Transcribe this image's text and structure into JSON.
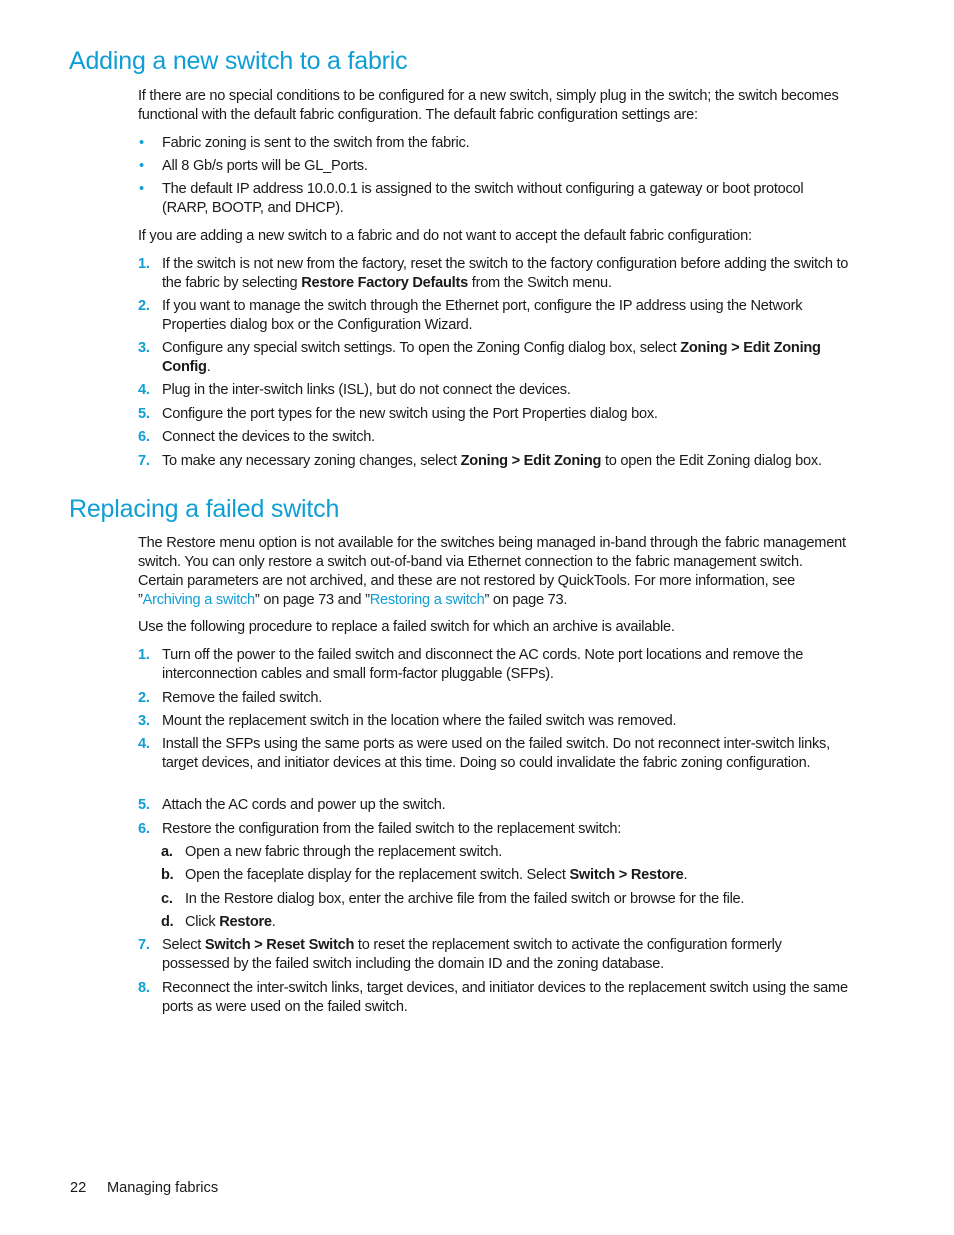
{
  "section1": {
    "title": "Adding a new switch to a fabric",
    "intro": "If there are no special conditions to be configured for a new switch, simply plug in the switch; the switch becomes functional with the default fabric configuration. The default fabric configuration settings are:",
    "bullet_icon": "•",
    "bullets": [
      "Fabric zoning is sent to the switch from the fabric.",
      "All 8 Gb/s ports will be GL_Ports.",
      "The default IP address 10.0.0.1 is assigned to the switch without configuring a gateway or boot protocol (RARP, BOOTP, and DHCP)."
    ],
    "lead": "If you are adding a new switch to a fabric and do not want to accept the default fabric configuration:",
    "steps": [
      {
        "num": "1.",
        "pre": "If the switch is not new from the factory, reset the switch to the factory configuration before adding the switch to the fabric by selecting ",
        "bold": "Restore Factory Defaults",
        "post": " from the Switch menu."
      },
      {
        "num": "2.",
        "pre": "If you want to manage the switch through the Ethernet port, configure the IP address using the Network Properties dialog box or the Configuration Wizard.",
        "bold": "",
        "post": ""
      },
      {
        "num": "3.",
        "pre": "Configure any special switch settings. To open the Zoning Config dialog box, select ",
        "bold": "Zoning > Edit Zoning Config",
        "post": "."
      },
      {
        "num": "4.",
        "pre": "Plug in the inter-switch links (ISL), but do not connect the devices.",
        "bold": "",
        "post": ""
      },
      {
        "num": "5.",
        "pre": "Configure the port types for the new switch using the Port Properties dialog box.",
        "bold": "",
        "post": ""
      },
      {
        "num": "6.",
        "pre": "Connect the devices to the switch.",
        "bold": "",
        "post": ""
      },
      {
        "num": "7.",
        "pre": "To make any necessary zoning changes, select ",
        "bold": "Zoning > Edit Zoning",
        "post": " to open the Edit Zoning dialog box."
      }
    ]
  },
  "section2": {
    "title": "Replacing a failed switch",
    "intro_pre": "The Restore menu option is not available for the switches being managed in-band through the fabric management switch. You can only restore a switch out-of-band via Ethernet connection to the fabric management switch. Certain parameters are not archived, and these are not restored by QuickTools. For more information, see ”",
    "link1": "Archiving a switch",
    "intro_mid": "” on page 73 and ”",
    "link2": "Restoring a switch",
    "intro_post": "” on page 73.",
    "lead": "Use the following procedure to replace a failed switch for which an archive is available.",
    "steps": [
      {
        "num": "1.",
        "pre": "Turn off the power to the failed switch and disconnect the AC cords. Note port locations and remove the interconnection cables and small form-factor pluggable (SFPs).",
        "bold": "",
        "post": ""
      },
      {
        "num": "2.",
        "pre": "Remove the failed switch.",
        "bold": "",
        "post": ""
      },
      {
        "num": "3.",
        "pre": "Mount the replacement switch in the location where the failed switch was removed.",
        "bold": "",
        "post": ""
      },
      {
        "num": "4.",
        "pre": "Install the SFPs using the same ports as were used on the failed switch. Do not reconnect inter-switch links, target devices, and initiator devices at this time. Doing so could invalidate the fabric zoning configuration.",
        "bold": "",
        "post": ""
      },
      {
        "num": "5.",
        "pre": "Attach the AC cords and power up the switch.",
        "bold": "",
        "post": ""
      },
      {
        "num": "6.",
        "pre": "Restore the configuration from the failed switch to the replacement switch:",
        "bold": "",
        "post": ""
      },
      {
        "num": "7.",
        "pre": "Select ",
        "bold": "Switch > Reset Switch",
        "post": " to reset the replacement switch to activate the configuration formerly possessed by the failed switch including the domain ID and the zoning database."
      },
      {
        "num": "8.",
        "pre": "Reconnect the inter-switch links, target devices, and initiator devices to the replacement switch using the same ports as were used on the failed switch.",
        "bold": "",
        "post": ""
      }
    ],
    "substeps": [
      {
        "num": "a.",
        "pre": "Open a new fabric through the replacement switch.",
        "bold": "",
        "post": ""
      },
      {
        "num": "b.",
        "pre": "Open the faceplate display for the replacement switch. Select ",
        "bold": "Switch > Restore",
        "post": "."
      },
      {
        "num": "c.",
        "pre": "In the Restore dialog box, enter the archive file from the failed switch or browse for the file.",
        "bold": "",
        "post": ""
      },
      {
        "num": "d.",
        "pre": "Click ",
        "bold": "Restore",
        "post": "."
      }
    ]
  },
  "footer": {
    "page_number": "22",
    "chapter": "Managing fabrics"
  },
  "colors": {
    "accent": "#0f9ed5",
    "text": "#1a1a1a"
  }
}
